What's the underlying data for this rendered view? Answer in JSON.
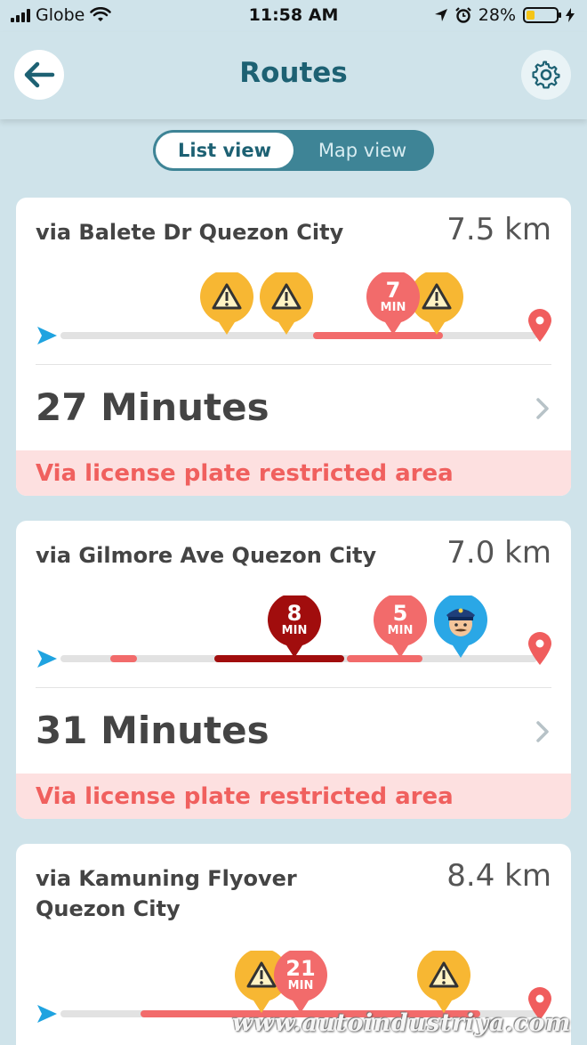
{
  "status_bar": {
    "carrier": "Globe",
    "time": "11:58 AM",
    "battery": "28%",
    "battery_level": 0.28
  },
  "header": {
    "title": "Routes",
    "back_icon": "back-arrow-icon",
    "settings_icon": "gear-icon"
  },
  "view_toggle": {
    "list_label": "List view",
    "map_label": "Map view",
    "selected": "List view"
  },
  "routes": [
    {
      "name": "via Balete Dr Quezon City",
      "distance": "7.5 km",
      "duration": "27 Minutes",
      "restriction": "Via license plate restricted area",
      "markers": [
        {
          "type": "hazard-icon"
        },
        {
          "type": "hazard-icon"
        },
        {
          "type": "delay",
          "value": "7",
          "unit": "MIN"
        },
        {
          "type": "hazard-icon"
        }
      ]
    },
    {
      "name": "via Gilmore Ave Quezon City",
      "distance": "7.0 km",
      "duration": "31 Minutes",
      "restriction": "Via license plate restricted area",
      "markers": [
        {
          "type": "delay-severe",
          "value": "8",
          "unit": "MIN"
        },
        {
          "type": "delay",
          "value": "5",
          "unit": "MIN"
        },
        {
          "type": "police-icon"
        }
      ]
    },
    {
      "name": "via Kamuning Flyover Quezon City",
      "distance": "8.4 km",
      "markers": [
        {
          "type": "hazard-icon"
        },
        {
          "type": "delay",
          "value": "21",
          "unit": "MIN"
        },
        {
          "type": "hazard-icon"
        }
      ]
    }
  ],
  "colors": {
    "brand": "#1d6173",
    "background": "#cfe3ea",
    "traffic_light": "#f26b6b",
    "traffic_heavy": "#a10d0d",
    "hazard": "#f7b733",
    "restriction_bg": "#fde0e0",
    "restriction_text": "#f0605e"
  },
  "watermark": "www.autoindustriya.com"
}
